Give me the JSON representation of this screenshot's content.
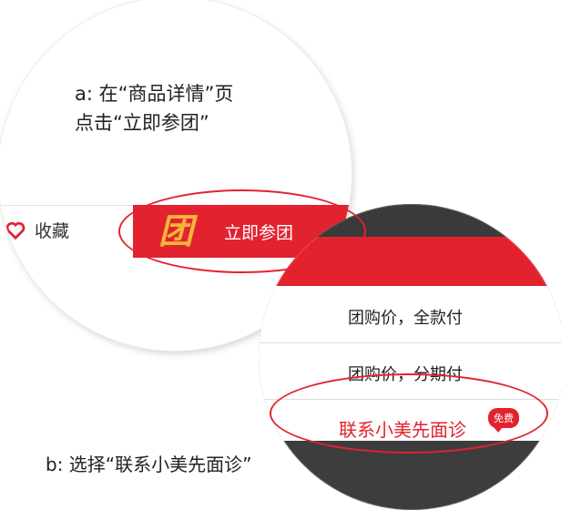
{
  "step_a": {
    "line1": "a: 在“商品详情”页",
    "line2": "点击“立即参团”"
  },
  "bottom_bar": {
    "favorite_label": "收藏",
    "join_label": "立即参团",
    "badge_glyph": "团"
  },
  "options_sheet": {
    "items": [
      {
        "label": "团购价，全款付"
      },
      {
        "label": "团购价，分期付"
      },
      {
        "label": "联系小美先面诊",
        "badge": "免费"
      }
    ]
  },
  "step_b": {
    "text": "b: 选择“联系小美先面诊”"
  },
  "colors": {
    "accent_red": "#e2232f",
    "badge_gold": "#f4b53a",
    "dark_header": "#3a3a3a"
  }
}
